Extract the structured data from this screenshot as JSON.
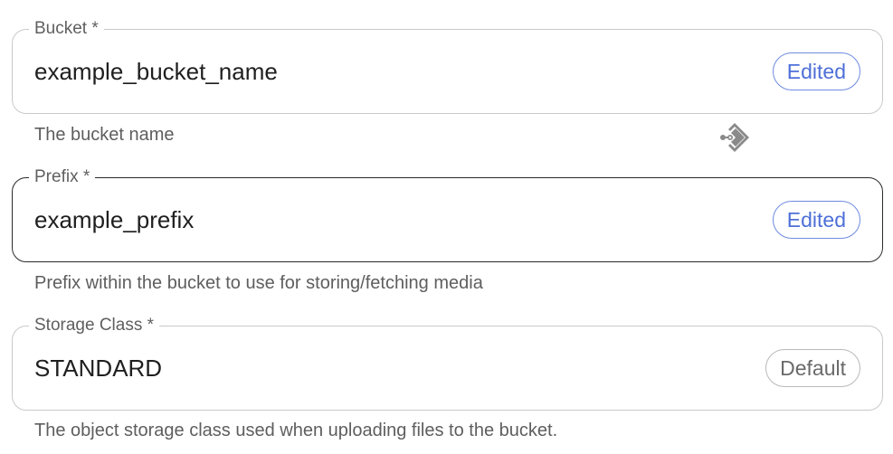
{
  "fields": [
    {
      "label": "Bucket",
      "required_mark": "*",
      "value": "example_bucket_name",
      "badge": "Edited",
      "helper": "The bucket name"
    },
    {
      "label": "Prefix",
      "required_mark": "*",
      "value": "example_prefix",
      "badge": "Edited",
      "helper": "Prefix within the bucket to use for storing/fetching media"
    },
    {
      "label": "Storage Class",
      "required_mark": "*",
      "value": "STANDARD",
      "badge": "Default",
      "helper": "The object storage class used when uploading files to the bucket."
    }
  ],
  "overlay_icon": "git-branch-icon",
  "colors": {
    "edited_badge": "#4e6fd8",
    "default_badge": "#6a6a6a",
    "focused_border": "#2a2a2a",
    "border": "#c9c9c9"
  }
}
